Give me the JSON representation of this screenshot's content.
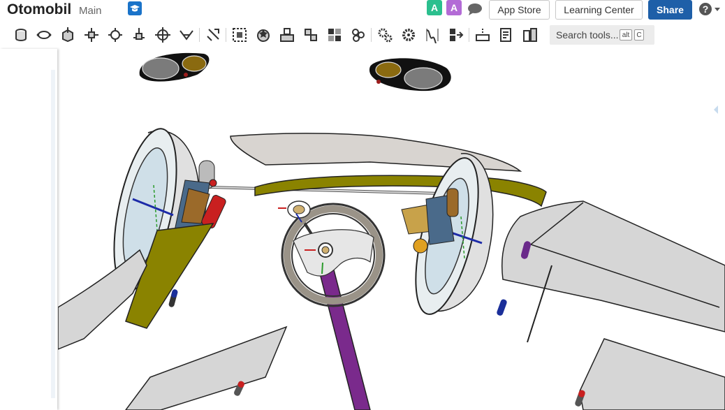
{
  "document": {
    "title": "Otomobil",
    "branch": "Main"
  },
  "header": {
    "avatars": [
      {
        "letter": "A",
        "color": "#2bbf8e"
      },
      {
        "letter": "A",
        "color": "#b36bd6"
      }
    ],
    "app_store_label": "App Store",
    "learning_center_label": "Learning Center",
    "share_label": "Share"
  },
  "toolbar": {
    "search_placeholder": "Search tools...",
    "shortcut_keys": [
      "alt",
      "C"
    ],
    "tools": [
      "sketch-tool",
      "extrude-tool",
      "revolve-tool",
      "sweep-tool",
      "loft-tool",
      "fillet-tool",
      "chamfer-tool",
      "shell-tool",
      "draft-tool",
      "rib-tool",
      "boolean-tool",
      "split-tool",
      "transform-tool",
      "pattern-tool",
      "mirror-tool",
      "mate-connector-tool",
      "plane-tool",
      "helix-tool",
      "thicken-tool",
      "enclose-tool",
      "gear-tool",
      "spur-gear-tool",
      "frame-tool",
      "variable-tool",
      "section-tool",
      "measure-tool",
      "part-studio-tool"
    ]
  },
  "colors": {
    "accent": "#1e5fa8",
    "olive_part": "#8a8300",
    "purple_shaft": "#7a2a8c"
  }
}
